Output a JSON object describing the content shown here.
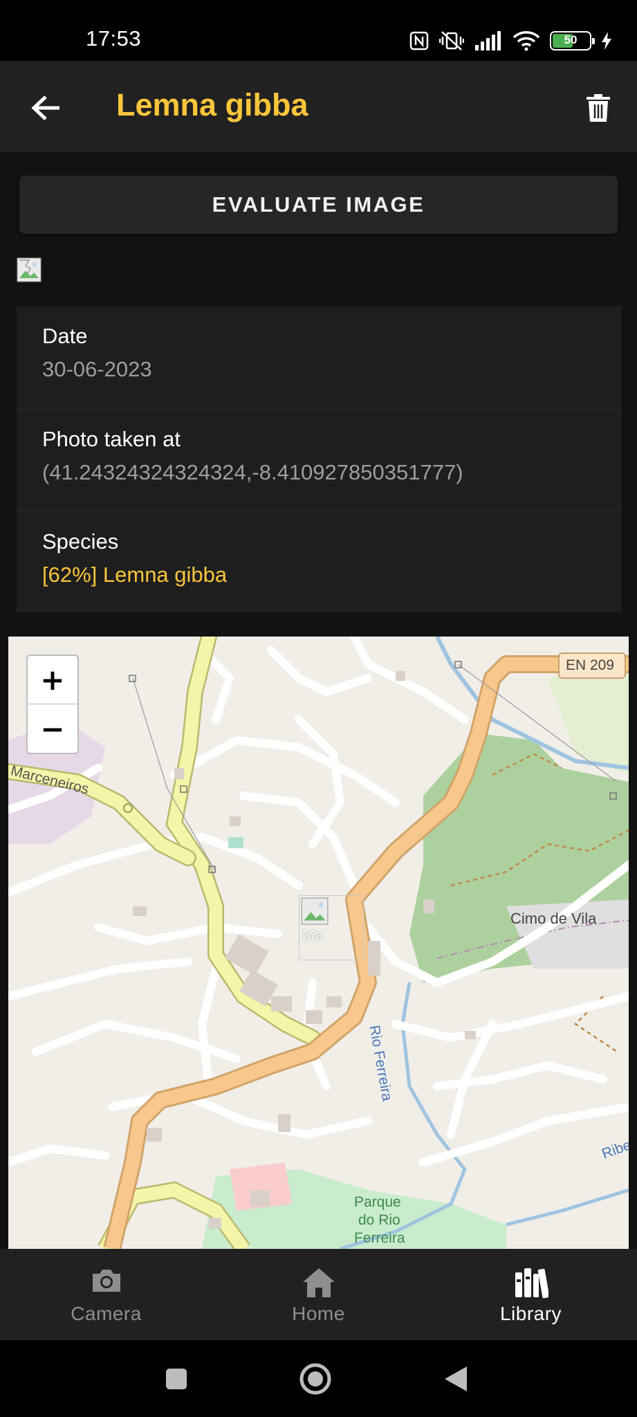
{
  "status_bar": {
    "time": "17:53",
    "battery_level": "50",
    "icons": [
      "nfc-icon",
      "vibrate-off-icon",
      "signal-icon",
      "wifi-icon",
      "battery-icon",
      "charging-icon"
    ]
  },
  "app_bar": {
    "title": "Lemna gibba",
    "back_icon": "arrow-left-icon",
    "delete_icon": "trash-icon"
  },
  "evaluate_button": {
    "label": "EVALUATE IMAGE"
  },
  "details": [
    {
      "label": "Date",
      "value": "30-06-2023"
    },
    {
      "label": "Photo taken at",
      "value": "(41.24324324324324,-8.410927850351777)"
    },
    {
      "label": "Species",
      "value": "[62%] Lemna gibba"
    }
  ],
  "map": {
    "zoom_in": "+",
    "zoom_out": "−",
    "labels": [
      "EN 209",
      "Marceneiros",
      "Cimo de Vila",
      "Rio Ferreira",
      "Parque",
      "do Rio",
      "Ferreira",
      "Ribe"
    ],
    "marker_alt": "Ma"
  },
  "bottom_nav": {
    "items": [
      {
        "label": "Camera",
        "icon": "camera-icon",
        "active": false
      },
      {
        "label": "Home",
        "icon": "home-icon",
        "active": false
      },
      {
        "label": "Library",
        "icon": "library-icon",
        "active": true
      }
    ]
  },
  "system_nav": [
    "recents-icon",
    "home-circle-icon",
    "back-triangle-icon"
  ],
  "colors": {
    "accent": "#f9c53b",
    "background": "#121212",
    "surface": "#1e1e1e",
    "app_bar": "#212121",
    "map_road_major": "#f8c78b",
    "map_road_secondary": "#f4f5a8",
    "map_forest": "#add19e",
    "map_water": "#9fc4e0"
  }
}
